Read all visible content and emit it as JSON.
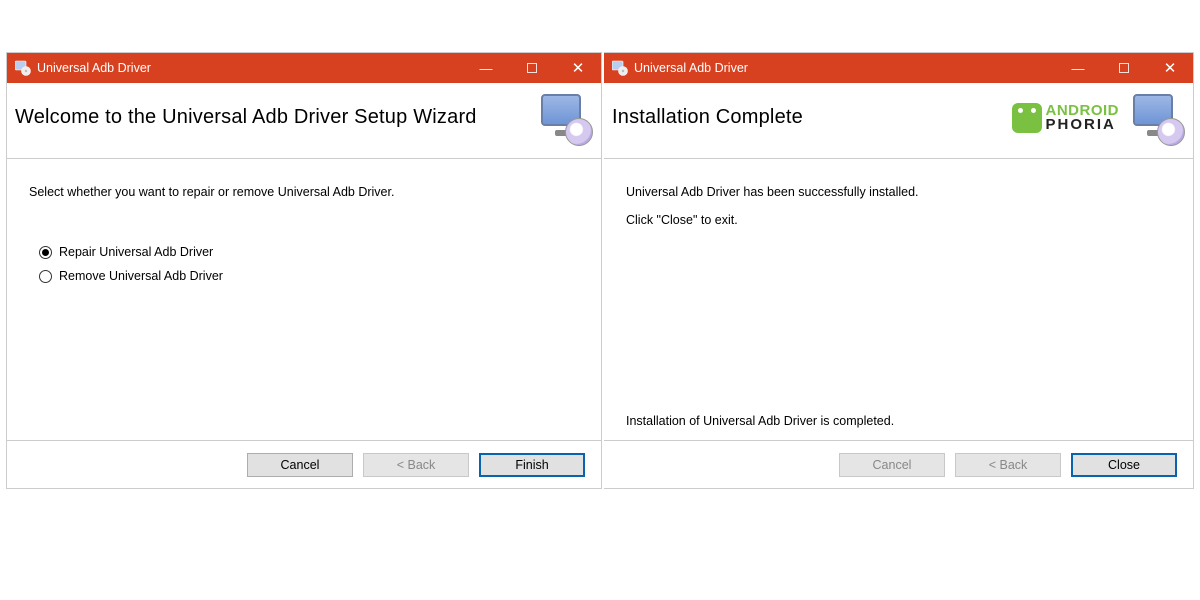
{
  "left_window": {
    "title": "Universal Adb Driver",
    "header": "Welcome to the Universal Adb Driver Setup Wizard",
    "instruction": "Select whether you want to repair or remove Universal Adb Driver.",
    "options": {
      "repair": "Repair Universal Adb Driver",
      "remove": "Remove Universal Adb Driver"
    },
    "buttons": {
      "cancel": "Cancel",
      "back": "< Back",
      "finish": "Finish"
    }
  },
  "right_window": {
    "title": "Universal Adb Driver",
    "header": "Installation Complete",
    "brand": {
      "line1": "ANDROID",
      "line2": "PHORIA"
    },
    "message1": "Universal Adb Driver has been successfully installed.",
    "message2": "Click \"Close\" to exit.",
    "status": "Installation of Universal Adb Driver is completed.",
    "buttons": {
      "cancel": "Cancel",
      "back": "< Back",
      "close": "Close"
    }
  }
}
